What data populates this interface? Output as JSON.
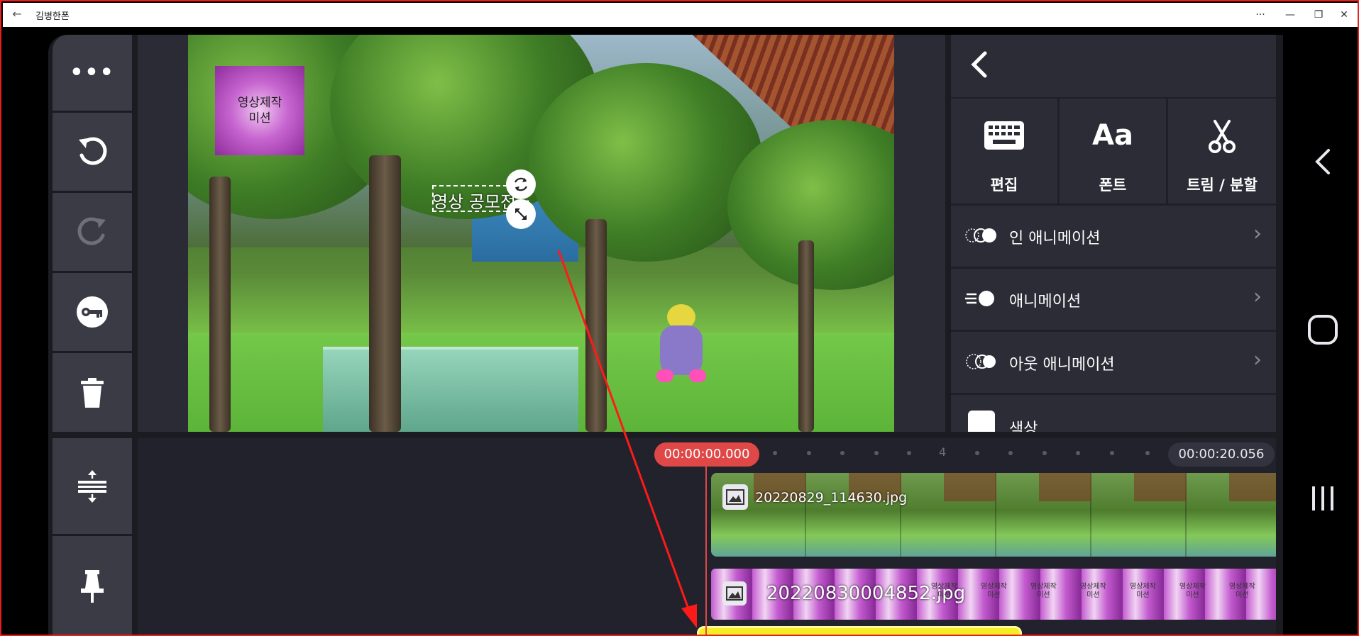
{
  "window": {
    "back_glyph": "←",
    "title": "김병한폰",
    "more_glyph": "···",
    "minimize_glyph": "—",
    "restore_glyph": "❐",
    "close_glyph": "✕"
  },
  "left_tools": [
    {
      "name": "more",
      "icon": "more-icon",
      "glyph": "•••"
    },
    {
      "name": "undo",
      "icon": "undo-icon",
      "glyph": "↺"
    },
    {
      "name": "redo",
      "icon": "redo-icon",
      "glyph": "↻"
    },
    {
      "name": "keyframe",
      "icon": "key-icon",
      "glyph": "⚿"
    },
    {
      "name": "delete",
      "icon": "trash-icon",
      "glyph": "🗑"
    }
  ],
  "timeline_tools": [
    {
      "name": "split-layers",
      "icon": "expand-vertical-icon",
      "glyph": "⇳"
    },
    {
      "name": "pin",
      "icon": "pin-icon",
      "glyph": "📌"
    }
  ],
  "preview": {
    "sticker_text": "영상제작\n미션",
    "text_layer": "영상 공모전"
  },
  "right_panel": {
    "back_glyph": "‹",
    "tools": [
      {
        "label": "편집",
        "icon": "keyboard-icon",
        "glyph": "⌨"
      },
      {
        "label": "폰트",
        "icon": "font-icon",
        "glyph": "Aa"
      },
      {
        "label": "트림 / 분할",
        "icon": "scissors-icon",
        "glyph": "✂"
      }
    ],
    "rows": [
      {
        "label": "인 애니메이션",
        "icon": "in-animation-icon"
      },
      {
        "label": "애니메이션",
        "icon": "animation-icon"
      },
      {
        "label": "아웃 애니메이션",
        "icon": "out-animation-icon"
      },
      {
        "label": "색상",
        "icon": "color-swatch-icon"
      }
    ],
    "chevron_glyph": "›"
  },
  "timeline": {
    "current_time": "00:00:00.000",
    "end_time": "00:00:20.056",
    "ruler_mark": "4",
    "clips": [
      {
        "name": "20220829_114630.jpg"
      },
      {
        "name": "20220830004852.jpg"
      }
    ],
    "thumb_text": "영상제작\n미션"
  },
  "colors": {
    "accent_red": "#e04848",
    "panel_dark": "#1f1f28",
    "button_gray": "#3b3b46",
    "sticker_purple": "#a23cb0",
    "text_clip_yellow": "#f5ee25",
    "annotation_arrow": "#ff1a1a"
  },
  "android_nav": {
    "back_glyph": "‹",
    "home_glyph": "□",
    "recents_glyph": "|||"
  }
}
